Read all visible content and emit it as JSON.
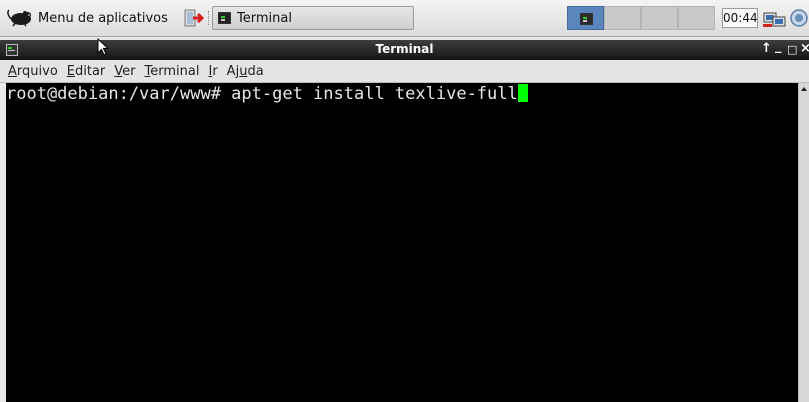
{
  "panel": {
    "app_menu_label": "Menu de aplicativos",
    "task_label": "Terminal",
    "clock": "00:44",
    "icons": {
      "app_menu": "xfce-mouse-icon",
      "launcher": "logout-icon",
      "task": "terminal-icon",
      "workspace": "terminal-icon",
      "network": "network-icon",
      "mixer": "volume-mixer-icon"
    },
    "workspaces": [
      {
        "active": true
      },
      {
        "active": false
      },
      {
        "active": false
      },
      {
        "active": false
      }
    ]
  },
  "window": {
    "title": "Terminal",
    "controls": {
      "shade": "↑",
      "minimize": "_",
      "maximize": "□",
      "close": "×"
    }
  },
  "menubar": {
    "items": [
      {
        "pre": "",
        "key": "A",
        "post": "rquivo"
      },
      {
        "pre": "",
        "key": "E",
        "post": "ditar"
      },
      {
        "pre": "",
        "key": "V",
        "post": "er"
      },
      {
        "pre": "",
        "key": "T",
        "post": "erminal"
      },
      {
        "pre": "",
        "key": "I",
        "post": "r"
      },
      {
        "pre": "Aj",
        "key": "u",
        "post": "da"
      }
    ]
  },
  "terminal": {
    "prompt": "root@debian:/var/www# ",
    "command": "apt-get install texlive-full",
    "cursor_color": "#00ff00",
    "background": "#000000"
  }
}
